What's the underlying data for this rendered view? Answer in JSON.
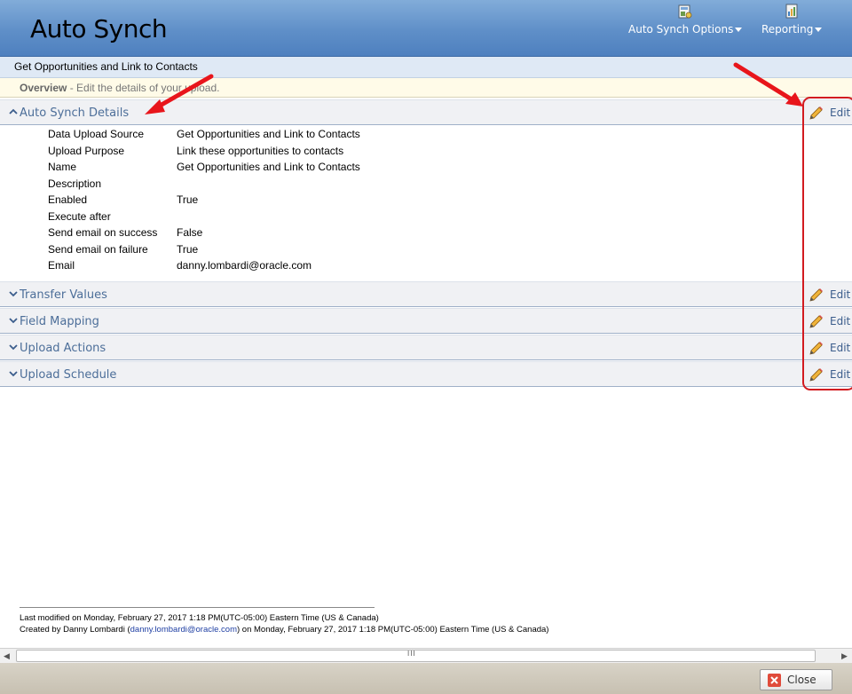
{
  "header": {
    "title": "Auto Synch",
    "menus": [
      {
        "label": "Auto Synch Options",
        "icon": "options-icon"
      },
      {
        "label": "Reporting",
        "icon": "reporting-icon"
      }
    ]
  },
  "subtitle": "Get Opportunities and Link to Contacts",
  "overview": {
    "label": "Overview",
    "separator": " - ",
    "text": "Edit the details of your upload."
  },
  "sections": [
    {
      "title": "Auto Synch Details",
      "expanded": true,
      "edit_label": "Edit"
    },
    {
      "title": "Transfer Values",
      "expanded": false,
      "edit_label": "Edit"
    },
    {
      "title": "Field Mapping",
      "expanded": false,
      "edit_label": "Edit"
    },
    {
      "title": "Upload Actions",
      "expanded": false,
      "edit_label": "Edit"
    },
    {
      "title": "Upload Schedule",
      "expanded": false,
      "edit_label": "Edit"
    }
  ],
  "details": [
    {
      "label": "Data Upload Source",
      "value": "Get Opportunities and Link to Contacts"
    },
    {
      "label": "Upload Purpose",
      "value": "Link these opportunities to contacts"
    },
    {
      "label": "Name",
      "value": "Get Opportunities and Link to Contacts"
    },
    {
      "label": "Description",
      "value": ""
    },
    {
      "label": "Enabled",
      "value": "True"
    },
    {
      "label": "Execute after",
      "value": ""
    },
    {
      "label": "Send email on success",
      "value": "False"
    },
    {
      "label": "Send email on failure",
      "value": "True"
    },
    {
      "label": "Email",
      "value": "danny.lombardi@oracle.com"
    }
  ],
  "footer": {
    "last_modified": "Last modified on Monday, February 27, 2017 1:18 PM(UTC-05:00) Eastern Time (US & Canada)",
    "created_prefix": "Created by Danny Lombardi (",
    "created_email": "danny.lombardi@oracle.com",
    "created_suffix": ") on Monday, February 27, 2017 1:18 PM(UTC-05:00) Eastern Time (US & Canada)"
  },
  "scrollbar": {
    "grip": "III"
  },
  "close_button": {
    "label": "Close"
  },
  "colors": {
    "header_blue": "#5f8fc8",
    "section_text": "#4c6e99",
    "annotation_red": "#e8151b",
    "link": "#1f3fa3"
  }
}
